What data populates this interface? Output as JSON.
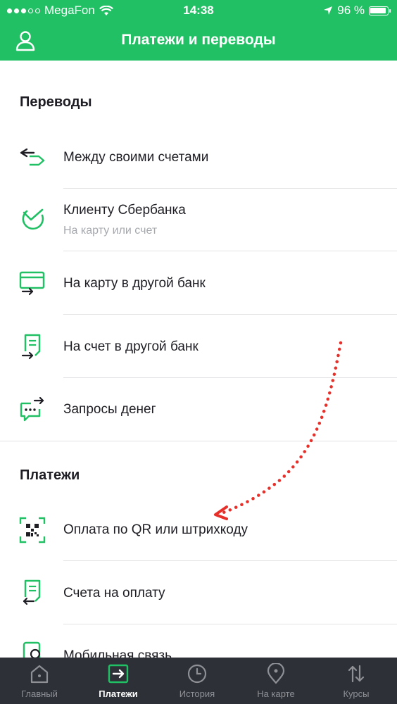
{
  "status": {
    "carrier": "MegaFon",
    "time": "14:38",
    "battery": "96 %"
  },
  "header": {
    "title": "Платежи и переводы"
  },
  "sections": {
    "transfers": {
      "title": "Переводы",
      "items": [
        {
          "label": "Между своими счетами",
          "icon": "arrows-exchange-icon"
        },
        {
          "label": "Клиенту Сбербанка",
          "sublabel": "На карту или счет",
          "icon": "sberbank-logo-icon"
        },
        {
          "label": "На карту в другой банк",
          "icon": "card-transfer-icon"
        },
        {
          "label": "На счет в другой банк",
          "icon": "document-transfer-icon"
        },
        {
          "label": "Запросы денег",
          "icon": "chat-request-icon"
        }
      ]
    },
    "payments": {
      "title": "Платежи",
      "items": [
        {
          "label": "Оплата по QR или штрихкоду",
          "icon": "qr-code-icon"
        },
        {
          "label": "Счета на оплату",
          "icon": "invoice-icon"
        },
        {
          "label": "Мобильная связь",
          "icon": "phone-icon"
        }
      ]
    }
  },
  "tabbar": {
    "items": [
      {
        "label": "Главный",
        "icon": "home-icon"
      },
      {
        "label": "Платежи",
        "icon": "payments-icon",
        "active": true
      },
      {
        "label": "История",
        "icon": "clock-icon"
      },
      {
        "label": "На карте",
        "icon": "map-pin-icon"
      },
      {
        "label": "Курсы",
        "icon": "exchange-rates-icon"
      }
    ]
  },
  "colors": {
    "brand": "#21c064",
    "tabbar": "#2d3037",
    "annotation": "#e8302a"
  }
}
